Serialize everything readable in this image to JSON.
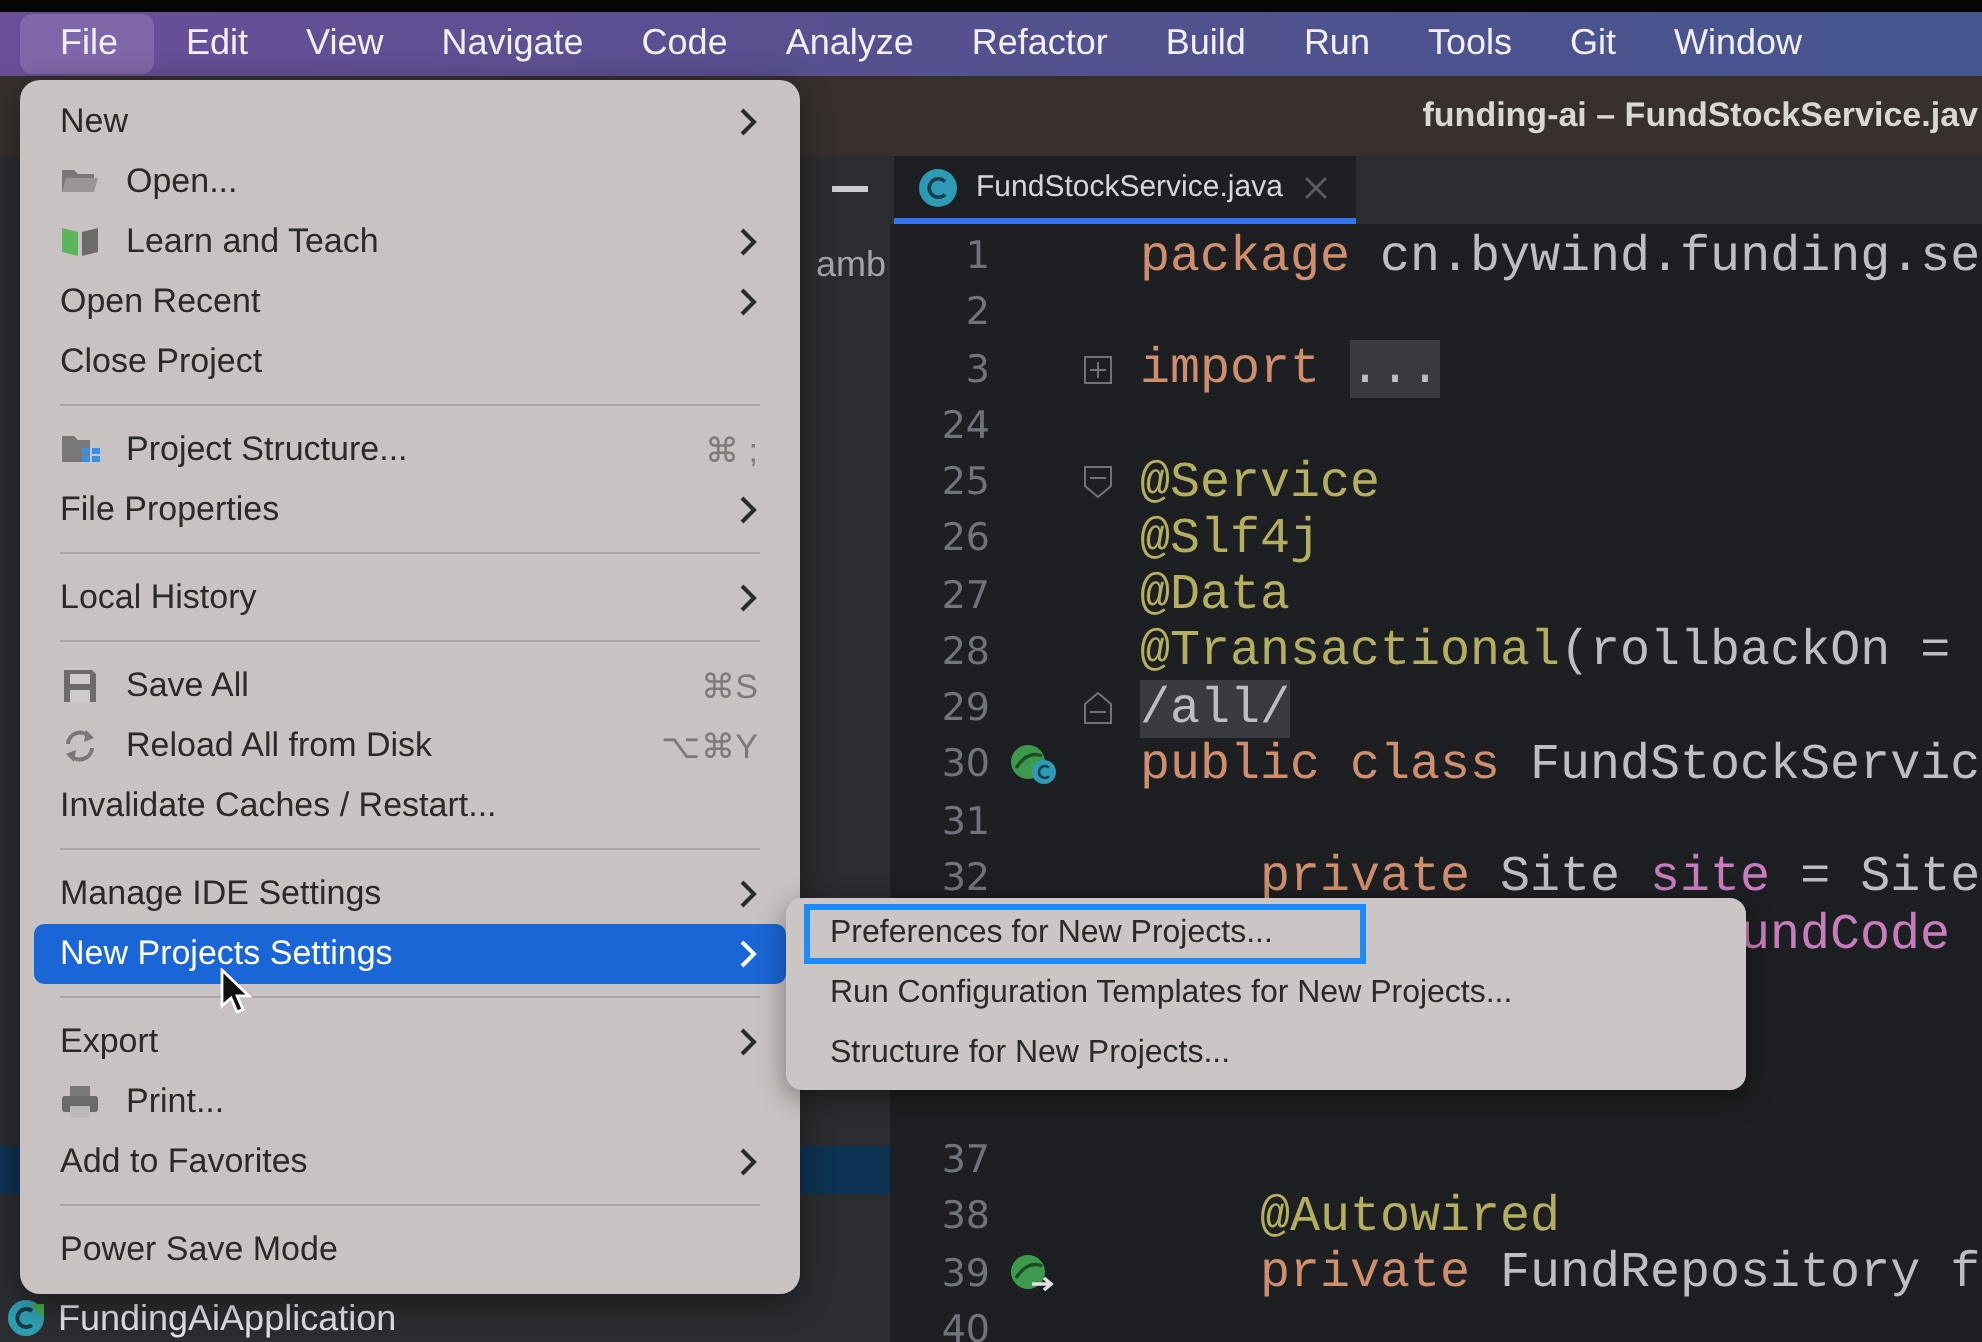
{
  "menubar": {
    "items": [
      {
        "label": "File",
        "selected": true
      },
      {
        "label": "Edit",
        "selected": false
      },
      {
        "label": "View",
        "selected": false
      },
      {
        "label": "Navigate",
        "selected": false
      },
      {
        "label": "Code",
        "selected": false
      },
      {
        "label": "Analyze",
        "selected": false
      },
      {
        "label": "Refactor",
        "selected": false
      },
      {
        "label": "Build",
        "selected": false
      },
      {
        "label": "Run",
        "selected": false
      },
      {
        "label": "Tools",
        "selected": false
      },
      {
        "label": "Git",
        "selected": false
      },
      {
        "label": "Window",
        "selected": false
      }
    ]
  },
  "window": {
    "title": "funding-ai – FundStockService.jav"
  },
  "project_pane": {
    "rows": [
      {
        "label": "amb",
        "selected": false
      },
      {
        "selected": true
      },
      {
        "label": "FundingAiApplication",
        "selected": false,
        "kind": "class"
      }
    ]
  },
  "editor": {
    "tabs": [
      {
        "label": "FundStockService.java",
        "selected": true
      }
    ],
    "lines": [
      {
        "number": "1",
        "kind": "code",
        "tokens": [
          {
            "text": "package",
            "kind": "keyword"
          },
          {
            "text": " cn.bywind.funding.se",
            "kind": "plain"
          }
        ]
      },
      {
        "number": "2",
        "kind": "code"
      },
      {
        "number": "3",
        "kind": "code",
        "fold": {
          "kind": "collapsed"
        },
        "tokens": [
          {
            "text": "import ",
            "kind": "keyword"
          },
          {
            "text": "...",
            "kind": "folded"
          }
        ]
      },
      {
        "number": "24",
        "kind": "code"
      },
      {
        "number": "25",
        "kind": "code",
        "fold": {
          "kind": "start"
        },
        "tokens": [
          {
            "text": "@Service",
            "kind": "annotation"
          }
        ]
      },
      {
        "number": "26",
        "kind": "code",
        "tokens": [
          {
            "text": "@Slf4j",
            "kind": "annotation"
          }
        ]
      },
      {
        "number": "27",
        "kind": "code",
        "tokens": [
          {
            "text": "@Data",
            "kind": "annotation"
          }
        ]
      },
      {
        "number": "28",
        "kind": "code",
        "tokens": [
          {
            "text": "@Transactional",
            "kind": "annotation"
          },
          {
            "text": "(rollbackOn =",
            "kind": "plain"
          }
        ]
      },
      {
        "number": "29",
        "kind": "code",
        "fold": {
          "kind": "end"
        },
        "tokens": [
          {
            "text": "/all/",
            "kind": "folded"
          }
        ]
      },
      {
        "number": "30",
        "kind": "code",
        "gutter": {
          "kind": "class"
        },
        "tokens": [
          {
            "text": "public class",
            "kind": "keyword"
          },
          {
            "text": " FundStockServic",
            "kind": "plain"
          }
        ]
      },
      {
        "number": "31",
        "kind": "code"
      },
      {
        "number": "32",
        "kind": "indented",
        "tokens": [
          {
            "text": "private",
            "kind": "keyword"
          },
          {
            "text": " Site ",
            "kind": "plain"
          },
          {
            "text": "site",
            "kind": "field"
          },
          {
            "text": " = Site",
            "kind": "plain"
          }
        ]
      },
      {
        "kind": "covered",
        "tokens": [
          {
            "text": "undCode",
            "kind": "field"
          }
        ]
      },
      {
        "kind": "covered"
      },
      {
        "kind": "covered"
      },
      {
        "kind": "covered"
      },
      {
        "number": "37",
        "kind": "code"
      },
      {
        "number": "38",
        "kind": "indented",
        "tokens": [
          {
            "text": "@Autowired",
            "kind": "annotation"
          }
        ]
      },
      {
        "number": "39",
        "kind": "indented",
        "gutter": {
          "kind": "bean"
        },
        "tokens": [
          {
            "text": "private",
            "kind": "keyword"
          },
          {
            "text": " FundRepository f",
            "kind": "plain"
          }
        ]
      },
      {
        "number": "40",
        "kind": "code"
      }
    ]
  },
  "file_menu": {
    "groups": [
      [
        {
          "label": "New",
          "submenu": true,
          "selected": false
        },
        {
          "label": "Open...",
          "kind": "open",
          "submenu": false,
          "selected": false
        },
        {
          "label": "Learn and Teach",
          "kind": "learn",
          "submenu": true,
          "selected": false
        },
        {
          "label": "Open Recent",
          "submenu": true,
          "selected": false
        },
        {
          "label": "Close Project",
          "submenu": false,
          "selected": false
        }
      ],
      [
        {
          "label": "Project Structure...",
          "kind": "structure",
          "shortcut": "⌘ ;",
          "submenu": false,
          "selected": false
        },
        {
          "label": "File Properties",
          "submenu": true,
          "selected": false
        }
      ],
      [
        {
          "label": "Local History",
          "submenu": true,
          "selected": false
        }
      ],
      [
        {
          "label": "Save All",
          "kind": "save",
          "shortcut": "⌘S",
          "submenu": false,
          "selected": false
        },
        {
          "label": "Reload All from Disk",
          "kind": "reload",
          "shortcut": "⌥⌘Y",
          "submenu": false,
          "selected": false
        },
        {
          "label": "Invalidate Caches / Restart...",
          "submenu": false,
          "selected": false
        }
      ],
      [
        {
          "label": "Manage IDE Settings",
          "submenu": true,
          "selected": false
        },
        {
          "label": "New Projects Settings",
          "submenu": true,
          "selected": true
        }
      ],
      [
        {
          "label": "Export",
          "submenu": true,
          "selected": false
        },
        {
          "label": "Print...",
          "kind": "print",
          "submenu": false,
          "selected": false
        },
        {
          "label": "Add to Favorites",
          "submenu": true,
          "selected": false
        }
      ],
      [
        {
          "label": "Power Save Mode",
          "submenu": false,
          "selected": false
        }
      ]
    ]
  },
  "submenu": {
    "items": [
      {
        "label": "Preferences for New Projects...",
        "outlined": true
      },
      {
        "label": "Run Configuration Templates for New Projects...",
        "outlined": false
      },
      {
        "label": "Structure for New Projects...",
        "outlined": false
      }
    ]
  }
}
